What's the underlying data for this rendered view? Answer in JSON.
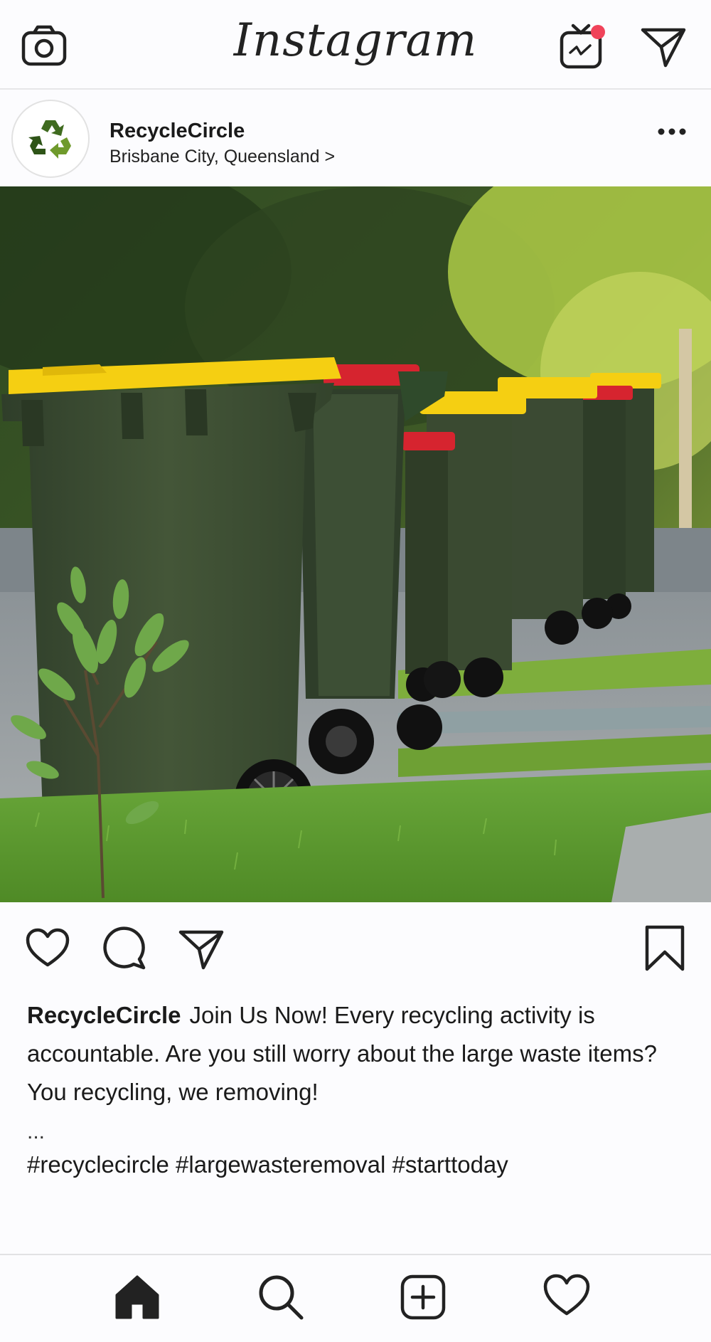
{
  "app": {
    "title": "Instagram"
  },
  "topbar": {
    "camera_icon": "camera-icon",
    "igtv_icon": "igtv-icon",
    "igtv_notification_color": "#f0435a",
    "direct_icon": "paper-plane-icon"
  },
  "post": {
    "username": "RecycleCircle",
    "location": "Brisbane City, Queensland >",
    "avatar_icon": "recycle-icon",
    "avatar_color": "#3f6b1f",
    "more_icon": "more-dots-icon",
    "caption_text": "Join Us Now! Every recycling activity is accountable. Are you still worry about the large waste items? You recycling, we removing!",
    "ellipsis": "...",
    "hashtags": "#recyclecircle #largewasteremoval #starttoday"
  },
  "actions": {
    "like_icon": "heart-icon",
    "comment_icon": "comment-icon",
    "share_icon": "paper-plane-icon",
    "save_icon": "bookmark-icon"
  },
  "bottom_nav": {
    "items": [
      {
        "icon": "home-icon",
        "active": true
      },
      {
        "icon": "search-icon"
      },
      {
        "icon": "add-post-icon"
      },
      {
        "icon": "activity-heart-icon"
      }
    ]
  },
  "colors": {
    "bin_body": "#3b4a33",
    "lid_yellow": "#f5cf12",
    "lid_red": "#d6242f",
    "grass": "#5a9a2e"
  }
}
